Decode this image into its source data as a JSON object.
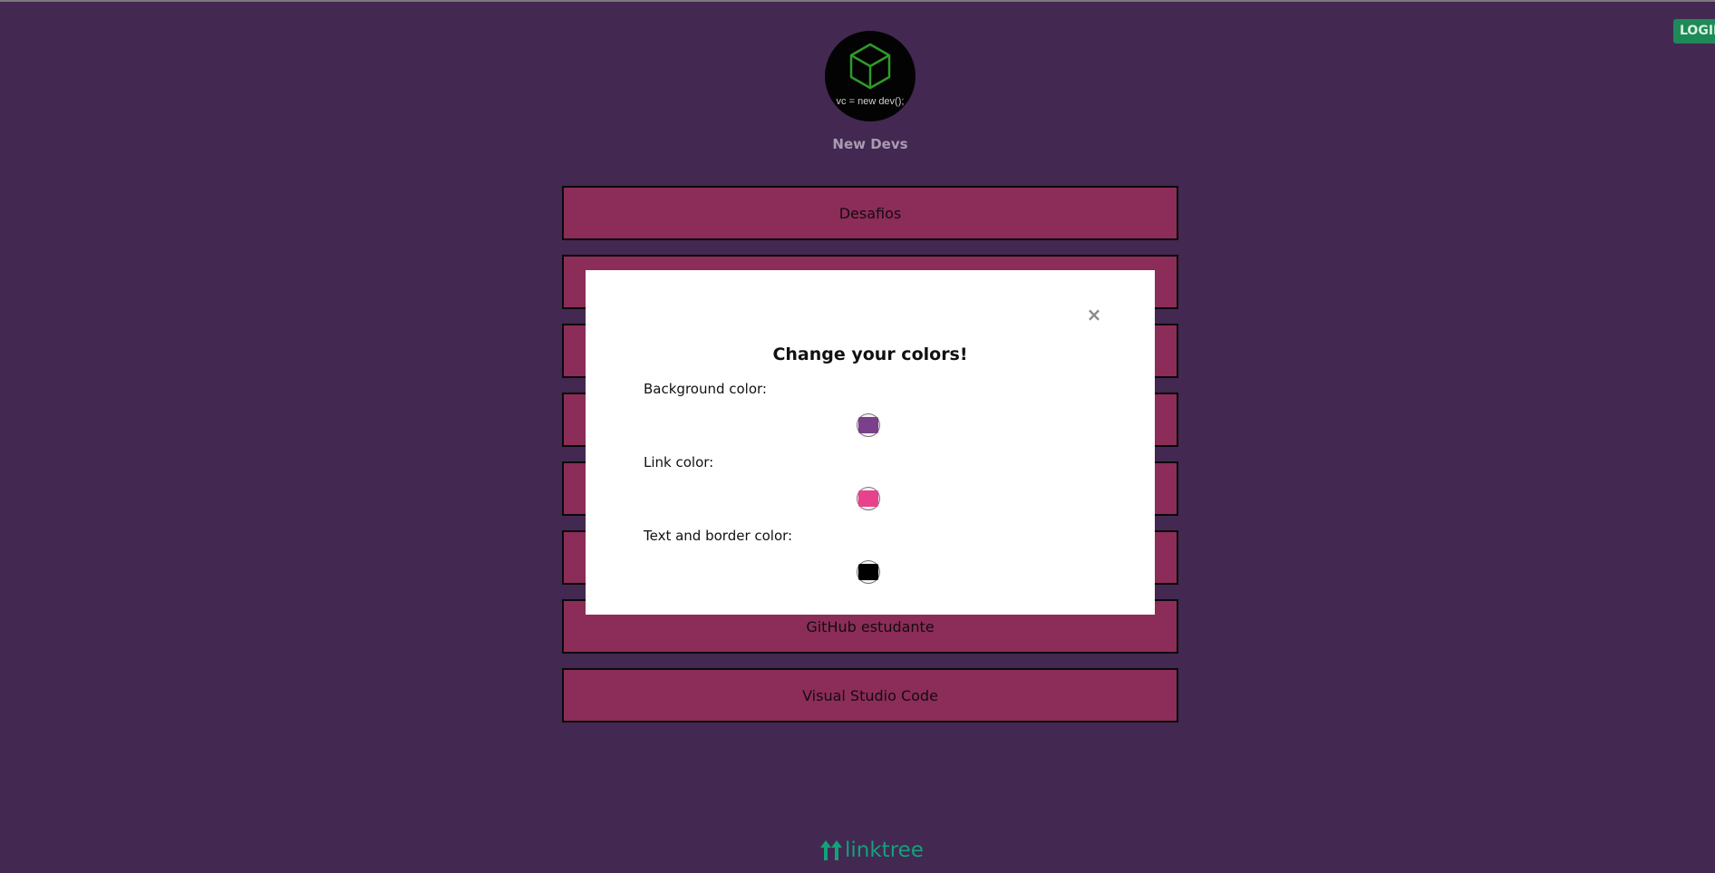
{
  "header": {
    "login_label": "LOGIN"
  },
  "profile": {
    "avatar_caption": "vc = new dev();",
    "name": "New Devs"
  },
  "links": [
    {
      "label": "Desafios"
    },
    {
      "label": ""
    },
    {
      "label": ""
    },
    {
      "label": ""
    },
    {
      "label": ""
    },
    {
      "label": ""
    },
    {
      "label": "GitHub estudante"
    },
    {
      "label": "Visual Studio Code"
    }
  ],
  "modal": {
    "close_label": "×",
    "title": "Change your colors!",
    "fields": [
      {
        "label": "Background color:",
        "value": "#7b3f8c"
      },
      {
        "label": "Link color:",
        "value": "#e8428c"
      },
      {
        "label": "Text and border color:",
        "value": "#000000"
      }
    ]
  },
  "footer": {
    "brand": "linktree"
  },
  "colors": {
    "page_background": "#432851",
    "link_background": "#8b2d58",
    "login_background": "#1e8a58",
    "brand_green": "#13a17a"
  },
  "icons": [
    "cube-icon",
    "close-icon",
    "linktree-logo-icon"
  ]
}
